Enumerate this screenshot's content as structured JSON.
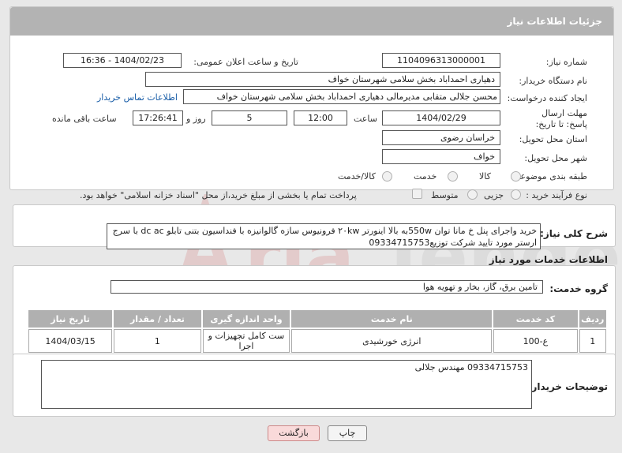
{
  "header": {
    "title": "جزئیات اطلاعات نیاز"
  },
  "form": {
    "need_number_label": "شماره نیاز:",
    "need_number": "1104096313000001",
    "announce_label": "تاریخ و ساعت اعلان عمومی:",
    "announce_value": "1404/02/23 - 16:36",
    "buyer_org_label": "نام دستگاه خریدار:",
    "buyer_org": "دهیاری احمداباد بخش سلامی شهرستان خواف",
    "creator_label": "ایجاد کننده درخواست:",
    "creator": "محسن جلالی متقابی مدیرمالی دهیاری احمداباد بخش سلامی شهرستان خواف",
    "contact_link": "اطلاعات تماس خریدار",
    "deadline_label": "مهلت ارسال پاسخ: تا تاریخ:",
    "deadline_date": "1404/02/29",
    "time_label": "ساعت",
    "deadline_time": "12:00",
    "days_value": "5",
    "days_label": "روز و",
    "remaining_time": "17:26:41",
    "remaining_label": "ساعت باقی مانده",
    "province_label": "استان محل تحویل:",
    "province": "خراسان رضوی",
    "city_label": "شهر محل تحویل:",
    "city": "خواف",
    "category_label": "طبقه بندی موضوعی:",
    "category_options": [
      "کالا",
      "خدمت",
      "کالا/خدمت"
    ],
    "process_label": "نوع فرآیند خرید :",
    "process_options": [
      "جزیی",
      "متوسط"
    ],
    "payment_note": "پرداخت تمام یا بخشی از مبلغ خرید،از محل \"اسناد خزانه اسلامی\" خواهد بود."
  },
  "description": {
    "label": "شرح کلی نیاز:",
    "text": "خرید واجرای پنل خ مانا توان 550wبه بالا اینورتر ۲۰kw فرونیوس سازه گالوانیزه با فنداسیون بتنی تابلو dc ac با سرج ارستر مورد تایید شرکت توزیع09334715753"
  },
  "services": {
    "section_title": "اطلاعات خدمات مورد نیاز",
    "group_label": "گروه خدمت:",
    "group_value": "تامین برق، گاز، بخار و تهویه هوا",
    "columns": [
      "ردیف",
      "کد خدمت",
      "نام خدمت",
      "واحد اندازه گیری",
      "تعداد / مقدار",
      "تاریخ نیاز"
    ],
    "rows": [
      [
        "1",
        "ع-100",
        "انرژی خورشیدی",
        "ست کامل تجهیزات و اجرا",
        "1",
        "1404/03/15"
      ]
    ]
  },
  "buyer_notes": {
    "label": "توضیحات خریدار:",
    "text": "09334715753 مهندس جلالی"
  },
  "buttons": {
    "print": "چاپ",
    "back": "بازگشت"
  },
  "colors": {
    "header": "#b3b3b3",
    "link": "#1a5ea8",
    "back_button": "#f9dada"
  }
}
